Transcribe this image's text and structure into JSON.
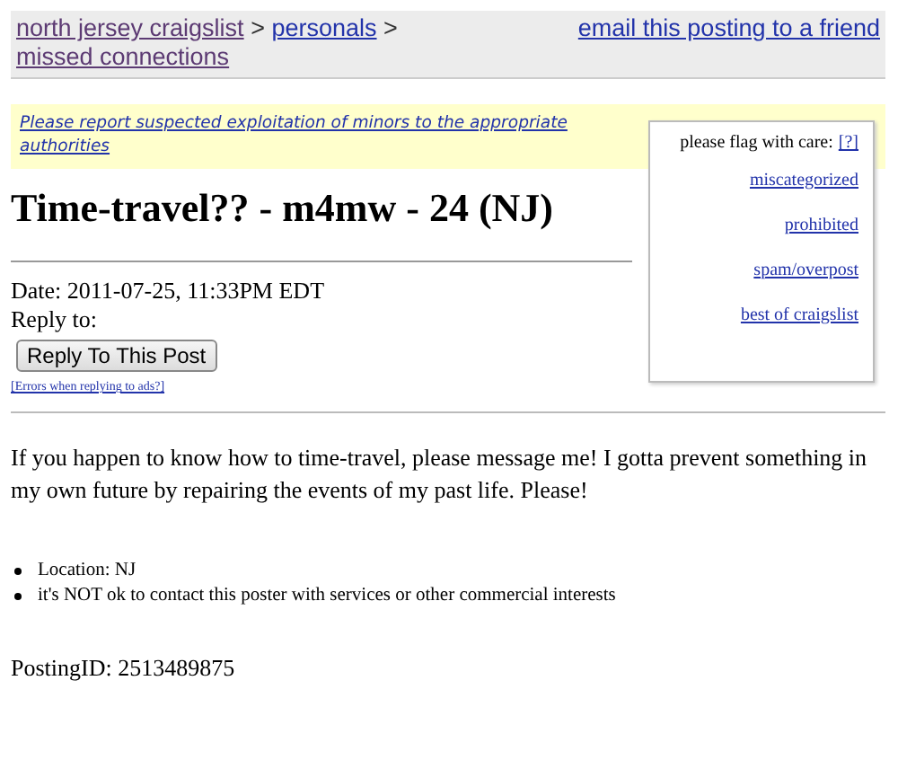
{
  "breadcrumb": [
    {
      "label": "north jersey craigslist",
      "visited": true
    },
    {
      "label": "personals",
      "visited": false
    },
    {
      "label": "missed connections",
      "visited": true
    }
  ],
  "breadcrumb_separator": ">",
  "email_link": {
    "label": "email this posting to a friend",
    "visited": false
  },
  "warning": "Please report suspected exploitation of minors to the appropriate authorities",
  "title": "Time-travel?? - m4mw - 24 (NJ)",
  "date": "Date: 2011-07-25, 11:33PM EDT",
  "reply_to": "Reply to:",
  "reply_button": "Reply To This Post",
  "errors_link": "[Errors when replying to ads?]",
  "flag_box": {
    "heading": "please flag with care:",
    "help_link": "[?]",
    "links": [
      "miscategorized",
      "prohibited",
      "spam/overpost",
      "best of craigslist"
    ]
  },
  "body": "If you happen to know how to time-travel, please message me! I gotta prevent something in my own future by repairing the events of my past life. Please!",
  "bullets": [
    "Location: NJ",
    "it's NOT ok to contact this poster with services or other commercial interests"
  ],
  "posting_id": "PostingID: 2513489875"
}
